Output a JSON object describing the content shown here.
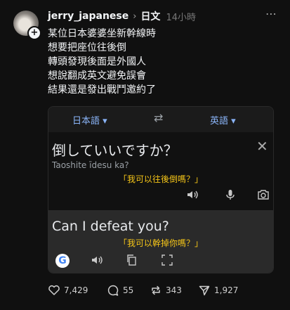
{
  "post": {
    "username": "jerry_japanese",
    "topic": "日文",
    "time": "14小時",
    "more_icon": "⋯",
    "lines": [
      "某位日本婆婆坐新幹線時",
      "想要把座位往後倒",
      "轉頭發現後面是外國人",
      "想說翻成英文避免誤會",
      "結果還是發出戰鬥邀約了"
    ]
  },
  "translate": {
    "source_lang": "日本語 ▾",
    "target_lang": "英語 ▾",
    "source_text": "倒していいですか？",
    "romaji": "Taoshite īdesu ka?",
    "source_caption": "「我可以往後倒嗎？」",
    "target_text": "Can I defeat you?",
    "target_caption": "「我可以幹掉你嗎？」",
    "google_letter": "G"
  },
  "actions": {
    "likes": "7,429",
    "comments": "55",
    "reposts": "343",
    "shares": "1,927"
  }
}
